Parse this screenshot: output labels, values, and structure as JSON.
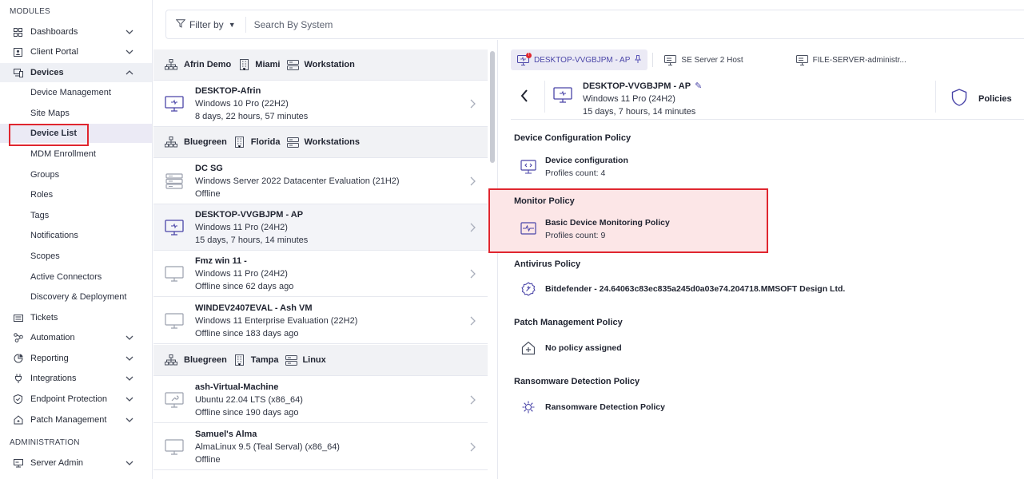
{
  "sidebar": {
    "modules_label": "MODULES",
    "admin_label": "ADMINISTRATION",
    "items": [
      {
        "label": "Dashboards",
        "icon": "dashboard-icon"
      },
      {
        "label": "Client Portal",
        "icon": "portal-icon"
      },
      {
        "label": "Devices",
        "icon": "devices-icon"
      },
      {
        "label": "Tickets",
        "icon": "ticket-icon"
      },
      {
        "label": "Automation",
        "icon": "automation-icon"
      },
      {
        "label": "Reporting",
        "icon": "reporting-icon"
      },
      {
        "label": "Integrations",
        "icon": "plug-icon"
      },
      {
        "label": "Endpoint Protection",
        "icon": "shield-icon"
      },
      {
        "label": "Patch Management",
        "icon": "patch-icon"
      },
      {
        "label": "Server Admin",
        "icon": "server-admin-icon"
      }
    ],
    "device_sub": [
      "Device Management",
      "Site Maps",
      "Device List",
      "MDM Enrollment",
      "Groups",
      "Roles",
      "Tags",
      "Notifications",
      "Scopes",
      "Active Connectors",
      "Discovery & Deployment"
    ]
  },
  "filter": {
    "label": "Filter by",
    "search_placeholder": "Search By System"
  },
  "groups": [
    {
      "client": "Afrin Demo",
      "site": "Miami",
      "type": "Workstation"
    },
    {
      "client": "Bluegreen",
      "site": "Florida",
      "type": "Workstations"
    },
    {
      "client": "Bluegreen",
      "site": "Tampa",
      "type": "Linux"
    }
  ],
  "devices": [
    {
      "name": "DESKTOP-Afrin",
      "os": "Windows 10 Pro (22H2)",
      "status": "8 days, 22 hours, 57 minutes",
      "icon": "workstation-online-icon"
    },
    {
      "name": "DC SG",
      "os": "Windows Server 2022 Datacenter Evaluation (21H2)",
      "status": "Offline",
      "icon": "server-icon"
    },
    {
      "name": "DESKTOP-VVGBJPM - AP",
      "os": "Windows 11 Pro (24H2)",
      "status": "15 days, 7 hours, 14 minutes",
      "icon": "workstation-online-icon"
    },
    {
      "name": "Fmz win 11 -",
      "os": "Windows 11 Pro (24H2)",
      "status": "Offline since 62 days ago",
      "icon": "workstation-offline-icon"
    },
    {
      "name": "WINDEV2407EVAL - Ash VM",
      "os": "Windows 11 Enterprise Evaluation (22H2)",
      "status": "Offline since 183 days ago",
      "icon": "workstation-offline-icon"
    },
    {
      "name": "ash-Virtual-Machine",
      "os": "Ubuntu 22.04 LTS (x86_64)",
      "status": "Offline since 190 days ago",
      "icon": "wrench-monitor-icon"
    },
    {
      "name": "Samuel's Alma",
      "os": "AlmaLinux 9.5 (Teal Serval) (x86_64)",
      "status": "Offline",
      "icon": "workstation-offline-icon"
    }
  ],
  "tabs": [
    {
      "label": "DESKTOP-VVGBJPM - AP",
      "badge": "!"
    },
    {
      "label": "SE Server 2 Host"
    },
    {
      "label": "FILE-SERVER-administr..."
    }
  ],
  "detail": {
    "name": "DESKTOP-VVGBJPM - AP",
    "os": "Windows 11 Pro (24H2)",
    "uptime": "15 days, 7 hours, 14 minutes",
    "policies_label": "Policies"
  },
  "policies": [
    {
      "title": "Device Configuration Policy",
      "name": "Device configuration",
      "count": "Profiles count: 4",
      "icon": "config-code-icon"
    },
    {
      "title": "Monitor Policy",
      "name": "Basic Device Monitoring Policy",
      "count": "Profiles count: 9",
      "icon": "monitor-pulse-icon"
    },
    {
      "title": "Antivirus Policy",
      "name": "Bitdefender - 24.64063c83ec835a245d0a03e74.204718.MMSOFT Design Ltd.",
      "icon": "antivirus-icon"
    },
    {
      "title": "Patch Management Policy",
      "name": "No policy assigned",
      "icon": "patch-house-icon"
    },
    {
      "title": "Ransomware Detection Policy",
      "name": "Ransomware Detection Policy",
      "icon": "ransomware-icon"
    }
  ],
  "colors": {
    "accent": "#4a45a8",
    "highlight_border": "#e0262f",
    "highlight_fill": "#fce6e7"
  }
}
